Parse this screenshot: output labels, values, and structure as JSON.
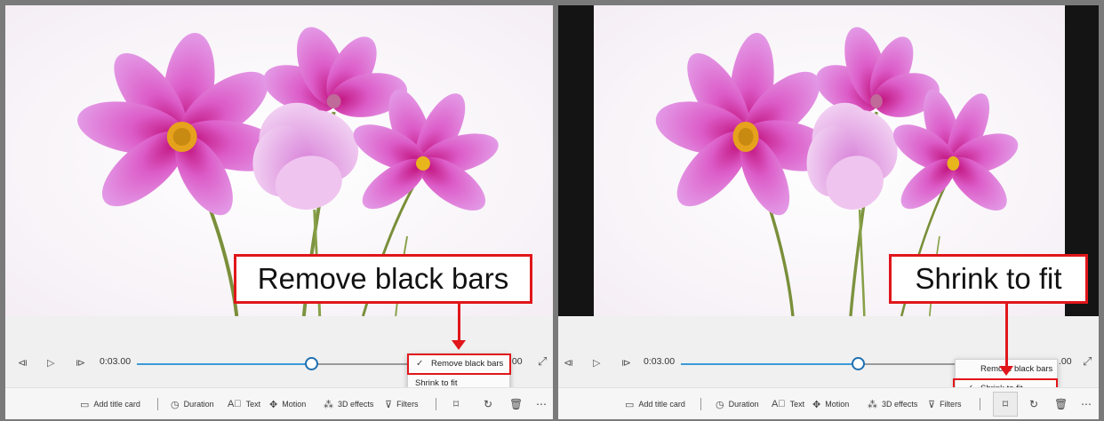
{
  "left": {
    "time": "0:03.00",
    "end_time": ".00",
    "menu": {
      "item1": "Remove black bars",
      "item2": "Shrink to fit",
      "checkmark": "✓"
    },
    "callout": "Remove black bars",
    "toolbar": {
      "add_title_card": "Add title card",
      "duration": "Duration",
      "text": "Text",
      "motion": "Motion",
      "effects_3d": "3D effects",
      "filters": "Filters"
    }
  },
  "right": {
    "time": "0:03.00",
    "end_time": ".00",
    "menu": {
      "item1": "Remove black bars",
      "item2": "Shrink to fit",
      "checkmark": "✓"
    },
    "callout": "Shrink to fit",
    "toolbar": {
      "add_title_card": "Add title card",
      "duration": "Duration",
      "text": "Text",
      "motion": "Motion",
      "effects_3d": "3D effects",
      "filters": "Filters"
    }
  },
  "colors": {
    "accent": "#e0161b",
    "slider_fill": "#3a9ad9",
    "slider_rest": "#9a9a9a",
    "black_bar": "#141414"
  },
  "icons": [
    "prev-frame-icon",
    "play-icon",
    "next-frame-icon",
    "expand-icon",
    "title-card-icon",
    "clock-icon",
    "text-icon",
    "motion-icon",
    "3d-effects-icon",
    "filters-icon",
    "crop-icon",
    "rotate-icon",
    "trash-icon",
    "more-icon"
  ]
}
